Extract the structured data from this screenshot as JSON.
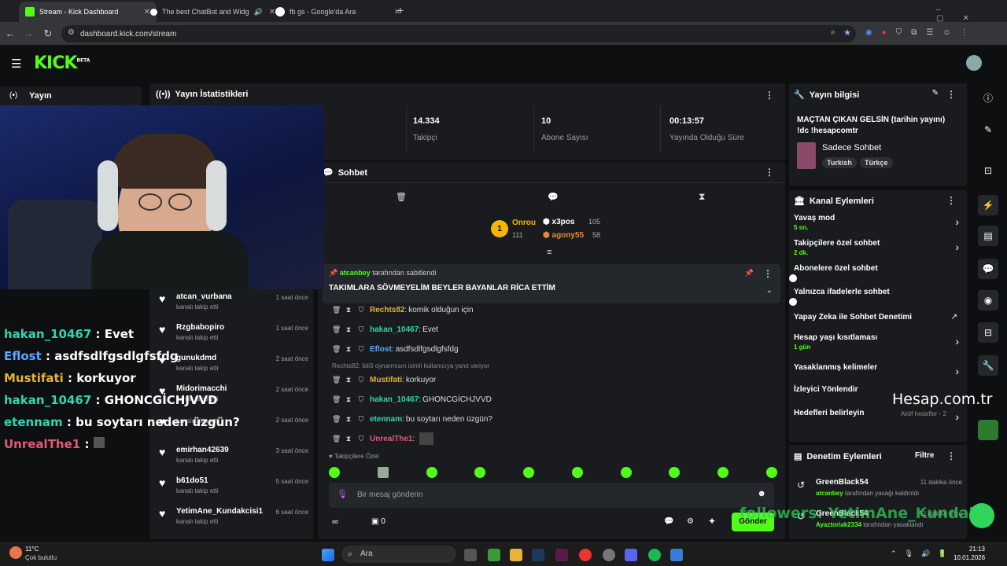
{
  "browser": {
    "tabs": [
      {
        "label": "Stream - Kick Dashboard"
      },
      {
        "label": "The best ChatBot and Widg"
      },
      {
        "label": "fb gs - Google'da Ara"
      }
    ],
    "url": "dashboard.kick.com/stream"
  },
  "app": {
    "logo": "KICK",
    "logo_badge": "BETA",
    "sidebar_item": "Yayın"
  },
  "stats": {
    "title": "Yayın İstatistikleri",
    "items": [
      {
        "value": "14.334",
        "label": "Takipçi"
      },
      {
        "value": "10",
        "label": "Abone Sayısı"
      },
      {
        "value": "00:13:57",
        "label": "Yayında Olduğu Süre"
      }
    ]
  },
  "chat": {
    "title": "Sohbet",
    "leaderboard": [
      {
        "name": "Onrou",
        "count": "111",
        "rank": "1"
      },
      {
        "name": "x3pos",
        "count": "105"
      },
      {
        "name": "agony55",
        "count": "58"
      }
    ],
    "pinned": {
      "by_user": "atcanbey",
      "by_suffix": "tarafından sabitlendi",
      "text": "TAKIMLARA SÖVMEYELİM BEYLER BAYANLAR RİCA ETTİM"
    },
    "messages": [
      {
        "user": "Rechts82",
        "text": "komik olduğun için",
        "color": "#e2b33a"
      },
      {
        "user": "hakan_10467",
        "text": "Evet",
        "color": "#2fd6b0"
      },
      {
        "user": "Eflost",
        "text": "asdfsdlfgsdlgfsfdg",
        "color": "#5aa8ff"
      },
      {
        "user": "Mustifati",
        "text": "korkuyor",
        "color": "#e2b33a"
      },
      {
        "user": "hakan_10467",
        "text": "GHONCGİCHJVVD",
        "color": "#2fd6b0"
      },
      {
        "user": "etennam",
        "text": "bu soytarı neden üzgün?",
        "color": "#2fd6b0"
      },
      {
        "user": "UnrealThe1",
        "text": "",
        "color": "#e05a7a"
      }
    ],
    "reply_note": "Rechts82: ibli3 oynarmısın isimli kullanıcıya yanıt veriyor",
    "followers_only": "Takipçilere Özel",
    "input_placeholder": "Bir mesaj gönderin",
    "send_label": "Gönder",
    "bottom_count": "0"
  },
  "followers": {
    "items": [
      {
        "name": "atcan_vurbana",
        "sub": "kanalı takip etti",
        "time": "1 saat önce"
      },
      {
        "name": "Rzgbabopiro",
        "sub": "kanalı takip etti",
        "time": "1 saat önce"
      },
      {
        "name": "gunukdmd",
        "sub": "kanalı takip etti",
        "time": "2 saat önce"
      },
      {
        "name": "Midorimacchi",
        "sub": "kanalı takip etti",
        "time": "2 saat önce"
      },
      {
        "name": "",
        "sub": "kanalı takip etti",
        "time": "2 saat önce"
      },
      {
        "name": "emirhan42639",
        "sub": "kanalı takip etti",
        "time": "3 saat önce"
      },
      {
        "name": "b61do51",
        "sub": "kanalı takip etti",
        "time": "5 saat önce"
      },
      {
        "name": "YetimAne_Kundakcisi1",
        "sub": "kanalı takip etti",
        "time": "6 saat önce"
      }
    ]
  },
  "overlay_chat": [
    {
      "user": "hakan_10467",
      "text": "Evet",
      "color": "#2fd6b0"
    },
    {
      "user": "Eflost",
      "text": "asdfsdlfgsdlgfsfdg",
      "color": "#5aa8ff"
    },
    {
      "user": "Mustifati",
      "text": "korkuyor",
      "color": "#e2b33a"
    },
    {
      "user": "hakan_10467",
      "text": "GHONCGİCHJVVD",
      "color": "#2fd6b0"
    },
    {
      "user": "etennam",
      "text": "bu soytarı neden üzgün?",
      "color": "#2fd6b0"
    },
    {
      "user": "UnrealThe1",
      "text": "",
      "color": "#e05a7a"
    }
  ],
  "stream_info": {
    "title": "Yayın bilgisi",
    "stream_title": "MAÇTAN ÇIKAN GELSİN (tarihin yayını) !dc !hesapcomtr",
    "category": "Sadece Sohbet",
    "tags": [
      "Turkish",
      "Türkçe"
    ]
  },
  "channel_actions": {
    "title": "Kanal Eylemleri",
    "items": [
      {
        "label": "Yavaş mod",
        "sub": "5 sn.",
        "control": "chevron"
      },
      {
        "label": "Takipçilere özel sohbet",
        "sub": "2 dk.",
        "control": "chevron"
      },
      {
        "label": "Abonelere özel sohbet",
        "sub": "",
        "control": "toggle"
      },
      {
        "label": "Yalnızca ifadelerle sohbet",
        "sub": "",
        "control": "toggle"
      },
      {
        "label": "Yapay Zeka ile Sohbet Denetimi",
        "sub": "",
        "control": "external"
      },
      {
        "label": "Hesap yaşı kısıtlaması",
        "sub": "1 gün",
        "control": "chevron"
      },
      {
        "label": "Yasaklanmış kelimeler",
        "sub": "",
        "control": "chevron"
      },
      {
        "label": "İzleyici Yönlendir",
        "sub": "",
        "control": "none"
      },
      {
        "label": "Hedefleri belirleyin",
        "sub": "",
        "control": "chevron"
      }
    ],
    "goals_status": "Aktif hedefler - 2"
  },
  "mod_actions": {
    "title": "Denetim Eylemleri",
    "filter": "Filtre",
    "items": [
      {
        "user": "GreenBlack54",
        "time": "11 dakika önce",
        "target": "atcanbey",
        "text": "tarafından yasağı kaldırıldı"
      },
      {
        "user": "GreenBlack54",
        "time": "11 dakika önce",
        "target": "Ayaztoriak2334",
        "text": "tarafından yasaklandı"
      }
    ]
  },
  "watermark": "Hesap.com.tr",
  "ticker": "followers: YetimAne_Kundakc",
  "taskbar": {
    "weather_temp": "11°C",
    "weather_desc": "Çok bulutlu",
    "search": "Ara",
    "time": "21:13",
    "date": "10.01.2026"
  }
}
